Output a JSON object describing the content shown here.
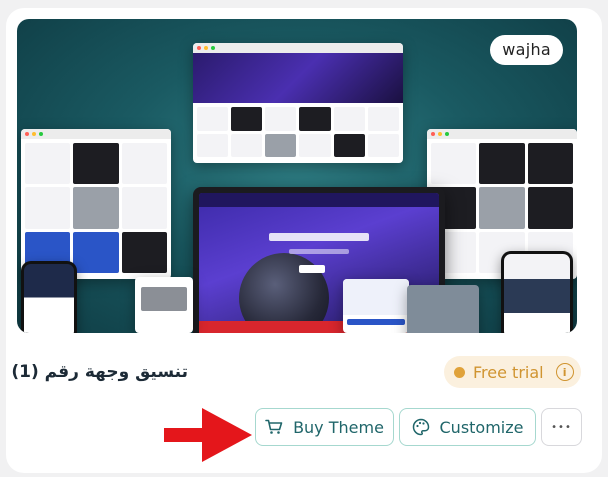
{
  "preview": {
    "brand_badge": "wajha"
  },
  "theme": {
    "title": "تنسيق وجهة رقم (1)",
    "trial_label": "Free trial",
    "trial_dot_color": "#e0a23a",
    "info_icon": "info-icon",
    "info_glyph": "i"
  },
  "actions": {
    "buy_label": "Buy Theme",
    "buy_icon": "cart-icon",
    "customize_label": "Customize",
    "customize_icon": "palette-icon",
    "more_label": "•••",
    "more_icon": "more-icon",
    "accent_color": "#20666a",
    "border_color": "#a6d8cf"
  },
  "annotation": {
    "arrow_color": "#e4161b",
    "arrow_icon": "red-arrow-icon"
  }
}
